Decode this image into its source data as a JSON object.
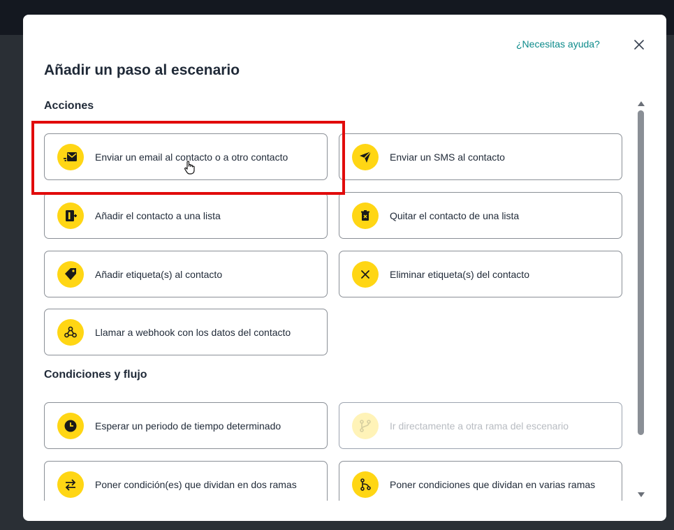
{
  "modal": {
    "help_link": "¿Necesitas ayuda?",
    "title": "Añadir un paso al escenario"
  },
  "sections": [
    {
      "title": "Acciones",
      "cards": [
        {
          "label": "Enviar un email al contacto o a otro contacto",
          "icon": "email-send-icon",
          "disabled": false
        },
        {
          "label": "Enviar un SMS al contacto",
          "icon": "send-arrow-icon",
          "disabled": false
        },
        {
          "label": "Añadir el contacto a una lista",
          "icon": "add-list-icon",
          "disabled": false
        },
        {
          "label": "Quitar el contacto de una lista",
          "icon": "trash-icon",
          "disabled": false
        },
        {
          "label": "Añadir etiqueta(s) al contacto",
          "icon": "tag-icon",
          "disabled": false
        },
        {
          "label": "Eliminar etiqueta(s) del contacto",
          "icon": "x-icon",
          "disabled": false
        },
        {
          "label": "Llamar a webhook con los datos del contacto",
          "icon": "webhook-icon",
          "disabled": false
        }
      ]
    },
    {
      "title": "Condiciones y flujo",
      "cards": [
        {
          "label": "Esperar un periodo de tiempo determinado",
          "icon": "clock-icon",
          "disabled": false
        },
        {
          "label": "Ir directamente a otra rama del escenario",
          "icon": "branch-icon",
          "disabled": true
        },
        {
          "label": "Poner condición(es) que dividan en dos ramas",
          "icon": "split-arrows-icon",
          "disabled": false
        },
        {
          "label": "Poner condiciones que dividan en varias ramas",
          "icon": "multi-branch-icon",
          "disabled": false
        }
      ]
    }
  ],
  "colors": {
    "accent_yellow": "#ffd614",
    "link_teal": "#0b8a8a",
    "highlight_red": "#e10b0b",
    "text_dark": "#1f2937"
  }
}
